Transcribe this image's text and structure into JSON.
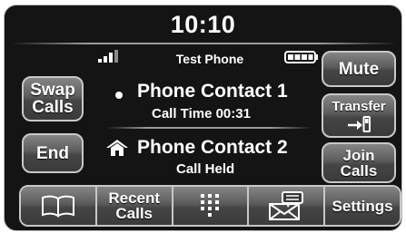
{
  "header": {
    "time": "10:10",
    "device_name": "Test Phone",
    "signal_icon": "signal-bars-icon",
    "battery_icon": "battery-icon"
  },
  "left_buttons": {
    "swap_line1": "Swap",
    "swap_line2": "Calls",
    "end": "End"
  },
  "right_buttons": {
    "mute": "Mute",
    "transfer": "Transfer",
    "transfer_icon": "transfer-to-phone-icon",
    "join_line1": "Join",
    "join_line2": "Calls"
  },
  "calls": [
    {
      "name": "Phone Contact 1",
      "status": "Call Time 00:31",
      "icon": "active-dot-icon"
    },
    {
      "name": "Phone Contact 2",
      "status": "Call Held",
      "icon": "house-icon"
    }
  ],
  "bottom_bar": {
    "phonebook_icon": "phonebook-icon",
    "recent_line1": "Recent",
    "recent_line2": "Calls",
    "keypad_icon": "keypad-icon",
    "messages_icon": "messages-icon",
    "settings": "Settings"
  }
}
